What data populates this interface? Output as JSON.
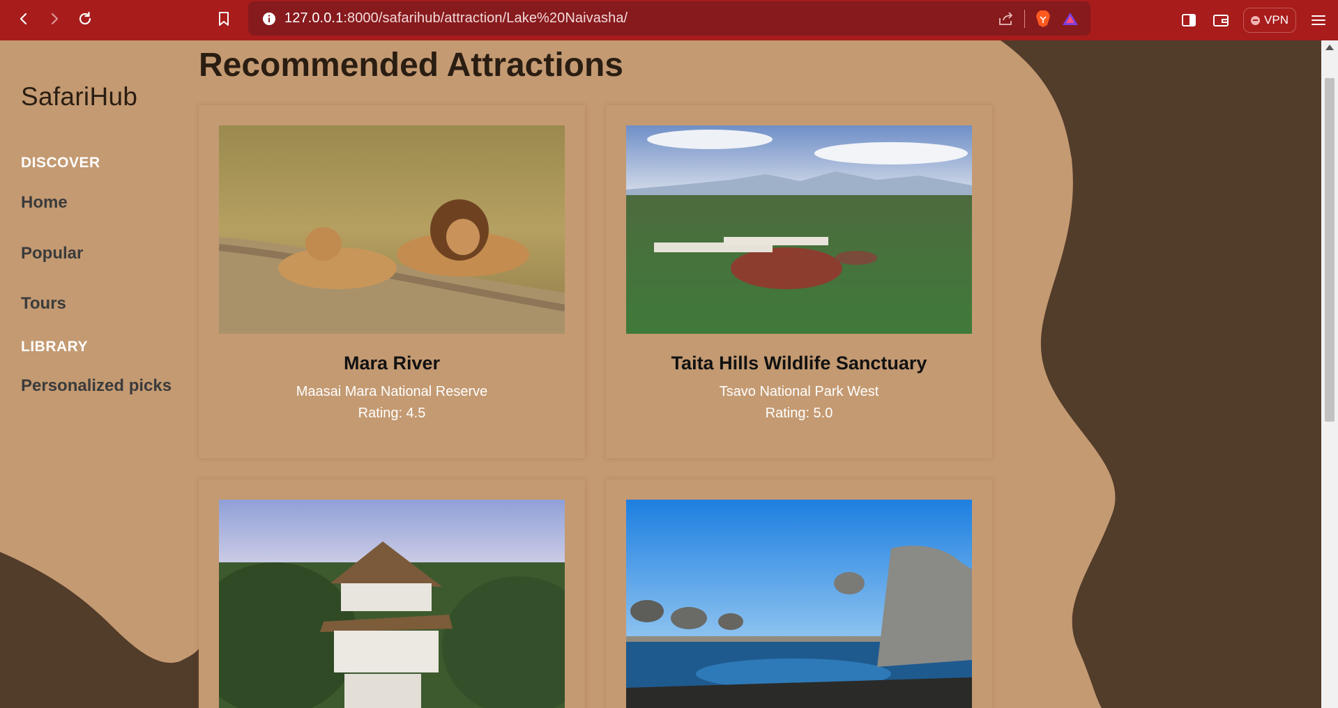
{
  "browser": {
    "url_host": "127.0.0.1",
    "url_rest": ":8000/safarihub/attraction/Lake%20Naivasha/",
    "vpn_label": "VPN"
  },
  "sidebar": {
    "brand": "SafariHub",
    "sections": [
      {
        "heading": "DISCOVER",
        "items": [
          "Home",
          "Popular",
          "Tours"
        ]
      },
      {
        "heading": "LIBRARY",
        "items": [
          "Personalized picks"
        ]
      }
    ]
  },
  "main": {
    "title": "Recommended Attractions",
    "cards": [
      {
        "name": "Mara River",
        "location": "Maasai Mara National Reserve",
        "rating": "Rating: 4.5",
        "image": "lions-on-savanna"
      },
      {
        "name": "Taita Hills Wildlife Sanctuary",
        "location": "Tsavo National Park West",
        "rating": "Rating: 5.0",
        "image": "aerial-savanna-lodge"
      },
      {
        "name": "",
        "location": "",
        "rating": "",
        "image": "thatched-coastal-villa"
      },
      {
        "name": "",
        "location": "",
        "rating": "",
        "image": "elephants-at-waterhole"
      }
    ]
  },
  "colors": {
    "chrome": "#a81c1c",
    "page_bg": "#c49a72",
    "dark_shape": "#523c2a"
  }
}
